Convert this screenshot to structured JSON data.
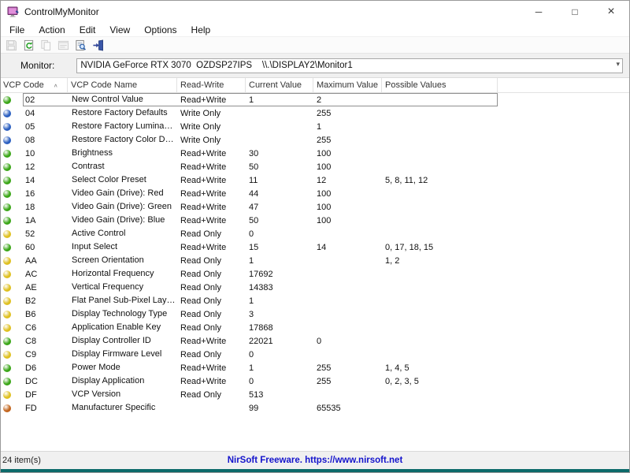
{
  "window": {
    "title": "ControlMyMonitor"
  },
  "icons": {
    "minimize": "─",
    "maximize": "□",
    "close": "×",
    "dropdown_chevron": "▾",
    "sort_ascending": "∧"
  },
  "menu": {
    "items": [
      "File",
      "Action",
      "Edit",
      "View",
      "Options",
      "Help"
    ]
  },
  "toolbar": {
    "icons": [
      "save-icon",
      "refresh-icon",
      "copy-icon",
      "properties-icon",
      "properties-dialog-icon",
      "exit-icon"
    ]
  },
  "monitor_bar": {
    "label": "Monitor:",
    "value": "NVIDIA GeForce RTX 3070  OZDSP27IPS    \\\\.\\DISPLAY2\\Monitor1"
  },
  "colors": {
    "dots": {
      "green": "#3aa617",
      "blue": "#2b5fc0",
      "yellow": "#dfc020",
      "orange": "#c2641c"
    },
    "status_link": "#1414cc",
    "desktop": "#0c6a6a"
  },
  "table": {
    "columns": [
      {
        "label": "VCP Code",
        "sorted": true
      },
      {
        "label": "VCP Code Name"
      },
      {
        "label": "Read-Write"
      },
      {
        "label": "Current Value"
      },
      {
        "label": "Maximum Value"
      },
      {
        "label": "Possible Values"
      }
    ],
    "rows": [
      {
        "code": "02",
        "name": "New Control Value",
        "rw": "Read+Write",
        "current": "1",
        "max": "2",
        "possible": "",
        "icon": "green",
        "selected": true
      },
      {
        "code": "04",
        "name": "Restore Factory Defaults",
        "rw": "Write Only",
        "current": "",
        "max": "255",
        "possible": "",
        "icon": "blue"
      },
      {
        "code": "05",
        "name": "Restore Factory Luminance/ ...",
        "rw": "Write Only",
        "current": "",
        "max": "1",
        "possible": "",
        "icon": "blue"
      },
      {
        "code": "08",
        "name": "Restore Factory Color Defaul...",
        "rw": "Write Only",
        "current": "",
        "max": "255",
        "possible": "",
        "icon": "blue"
      },
      {
        "code": "10",
        "name": "Brightness",
        "rw": "Read+Write",
        "current": "30",
        "max": "100",
        "possible": "",
        "icon": "green"
      },
      {
        "code": "12",
        "name": "Contrast",
        "rw": "Read+Write",
        "current": "50",
        "max": "100",
        "possible": "",
        "icon": "green"
      },
      {
        "code": "14",
        "name": "Select Color Preset",
        "rw": "Read+Write",
        "current": "11",
        "max": "12",
        "possible": "5, 8, 11, 12",
        "icon": "green"
      },
      {
        "code": "16",
        "name": "Video Gain (Drive): Red",
        "rw": "Read+Write",
        "current": "44",
        "max": "100",
        "possible": "",
        "icon": "green"
      },
      {
        "code": "18",
        "name": "Video Gain (Drive): Green",
        "rw": "Read+Write",
        "current": "47",
        "max": "100",
        "possible": "",
        "icon": "green"
      },
      {
        "code": "1A",
        "name": "Video Gain (Drive): Blue",
        "rw": "Read+Write",
        "current": "50",
        "max": "100",
        "possible": "",
        "icon": "green"
      },
      {
        "code": "52",
        "name": "Active Control",
        "rw": "Read Only",
        "current": "0",
        "max": "",
        "possible": "",
        "icon": "yellow"
      },
      {
        "code": "60",
        "name": "Input Select",
        "rw": "Read+Write",
        "current": "15",
        "max": "14",
        "possible": "0, 17, 18, 15",
        "icon": "green"
      },
      {
        "code": "AA",
        "name": "Screen Orientation",
        "rw": "Read Only",
        "current": "1",
        "max": "",
        "possible": "1, 2",
        "icon": "yellow"
      },
      {
        "code": "AC",
        "name": "Horizontal Frequency",
        "rw": "Read Only",
        "current": "17692",
        "max": "",
        "possible": "",
        "icon": "yellow"
      },
      {
        "code": "AE",
        "name": "Vertical Frequency",
        "rw": "Read Only",
        "current": "14383",
        "max": "",
        "possible": "",
        "icon": "yellow"
      },
      {
        "code": "B2",
        "name": "Flat Panel Sub-Pixel Layout",
        "rw": "Read Only",
        "current": "1",
        "max": "",
        "possible": "",
        "icon": "yellow"
      },
      {
        "code": "B6",
        "name": "Display Technology Type",
        "rw": "Read Only",
        "current": "3",
        "max": "",
        "possible": "",
        "icon": "yellow"
      },
      {
        "code": "C6",
        "name": "Application Enable Key",
        "rw": "Read Only",
        "current": "17868",
        "max": "",
        "possible": "",
        "icon": "yellow"
      },
      {
        "code": "C8",
        "name": "Display Controller ID",
        "rw": "Read+Write",
        "current": "22021",
        "max": "0",
        "possible": "",
        "icon": "green"
      },
      {
        "code": "C9",
        "name": "Display Firmware Level",
        "rw": "Read Only",
        "current": "0",
        "max": "",
        "possible": "",
        "icon": "yellow"
      },
      {
        "code": "D6",
        "name": "Power Mode",
        "rw": "Read+Write",
        "current": "1",
        "max": "255",
        "possible": "1, 4, 5",
        "icon": "green"
      },
      {
        "code": "DC",
        "name": "Display Application",
        "rw": "Read+Write",
        "current": "0",
        "max": "255",
        "possible": "0, 2, 3, 5",
        "icon": "green"
      },
      {
        "code": "DF",
        "name": "VCP Version",
        "rw": "Read Only",
        "current": "513",
        "max": "",
        "possible": "",
        "icon": "yellow"
      },
      {
        "code": "FD",
        "name": "Manufacturer Specific",
        "rw": "",
        "current": "99",
        "max": "65535",
        "possible": "",
        "icon": "orange"
      }
    ]
  },
  "status_bar": {
    "items_count": "24 item(s)",
    "link": "NirSoft Freeware. https://www.nirsoft.net"
  }
}
